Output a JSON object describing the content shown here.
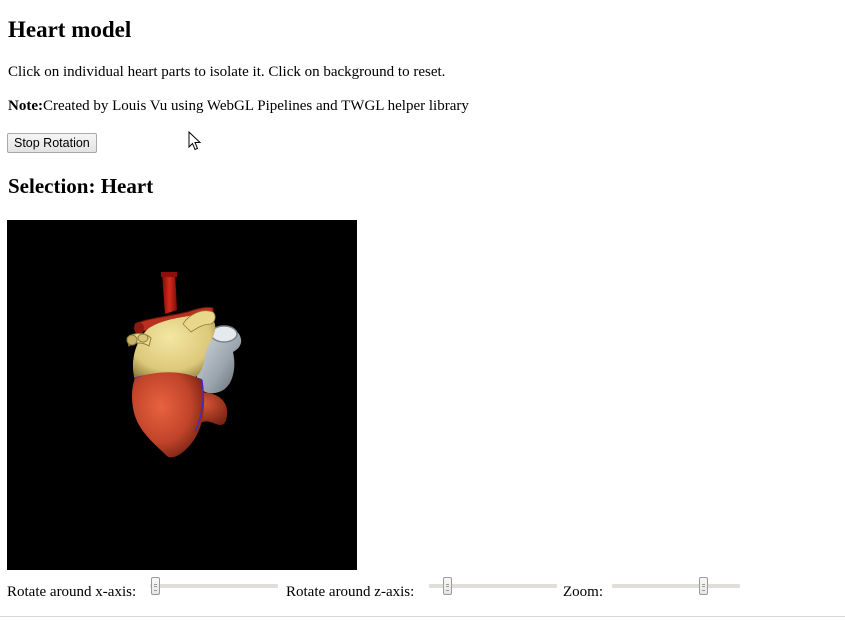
{
  "page": {
    "title": "Heart model",
    "intro": "Click on individual heart parts to isolate it. Click on background to reset.",
    "note_label": "Note:",
    "note_text": "Created by Louis Vu using WebGL Pipelines and TWGL helper library",
    "stop_button_label": "Stop Rotation",
    "selection_heading": "Selection: Heart"
  },
  "controls": {
    "rotate_x_label": "Rotate around x-axis:",
    "rotate_z_label": "Rotate around z-axis:",
    "zoom_label": "Zoom:",
    "rotate_x_value": 0.05,
    "rotate_z_value": 0.15,
    "zoom_value": 0.72
  },
  "colors": {
    "canvas_background": "#000000",
    "ventricle_red": "#c0442a",
    "atrium_yellow": "#e6d58a",
    "vein_gray": "#a7b0b8",
    "artery_red": "#b51c14"
  }
}
